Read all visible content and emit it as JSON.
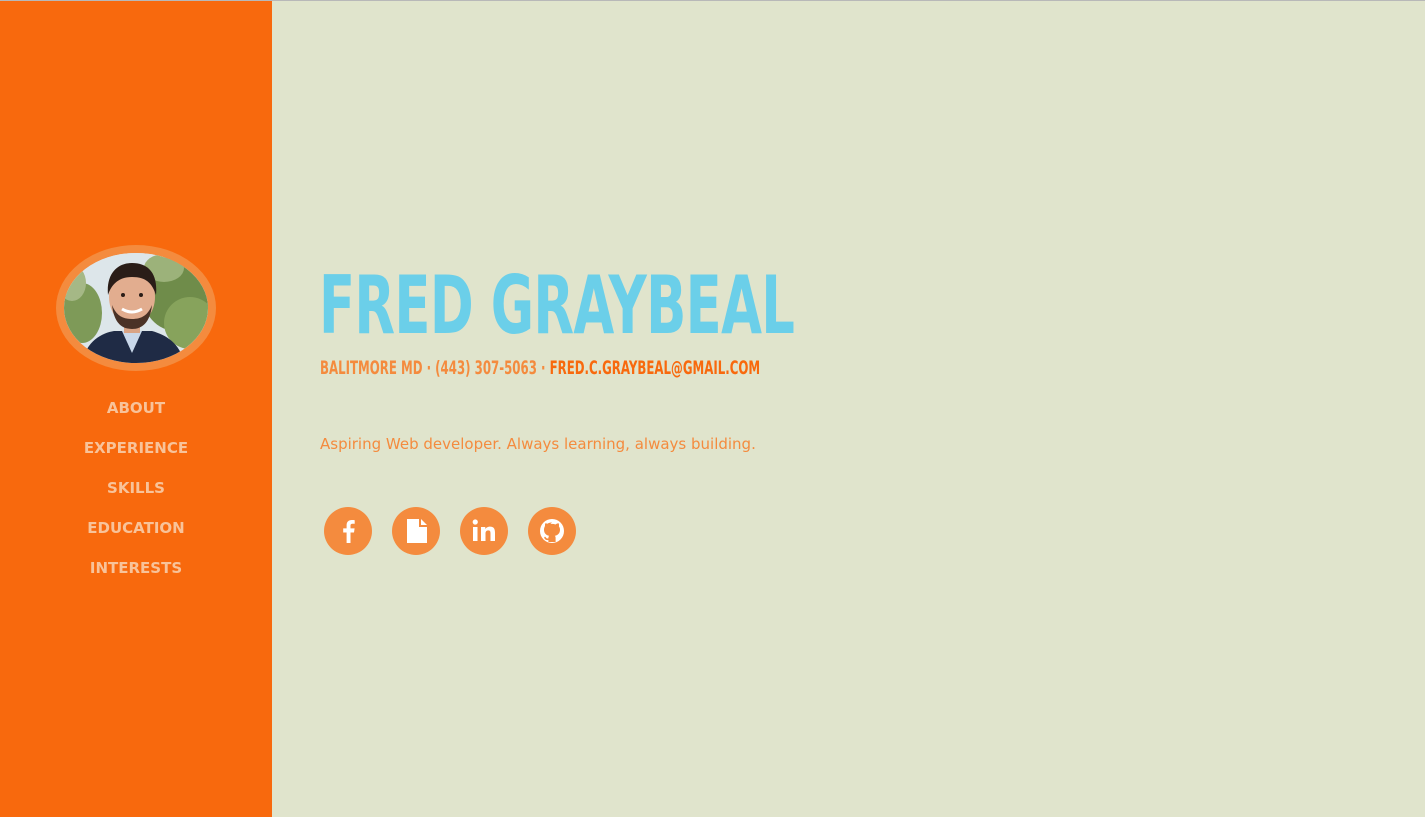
{
  "profile": {
    "name": "Fred Graybeal",
    "location": "Balitmore MD",
    "phone": "(443) 307-5063",
    "email": "fred.c.graybeal@gmail.com",
    "separator": "·",
    "tagline": "Aspiring Web developer. Always learning, always building."
  },
  "nav": {
    "items": [
      {
        "label": "ABOUT"
      },
      {
        "label": "EXPERIENCE"
      },
      {
        "label": "SKILLS"
      },
      {
        "label": "EDUCATION"
      },
      {
        "label": "INTERESTS"
      }
    ]
  },
  "social": {
    "icons": [
      "facebook-icon",
      "document-icon",
      "linkedin-icon",
      "github-icon"
    ]
  },
  "colors": {
    "sidebar": "#f8690d",
    "background": "#e0e4cc",
    "name": "#6bcfe9",
    "accent": "#f48b3e",
    "nav_text": "#f8c39a"
  }
}
